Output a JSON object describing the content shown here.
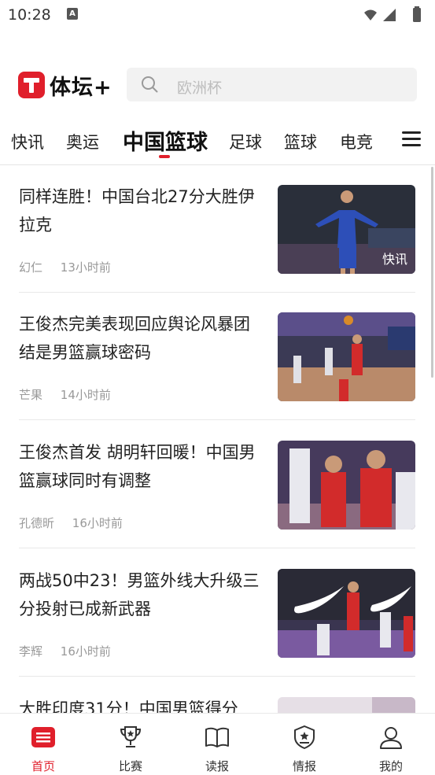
{
  "status_bar": {
    "time": "10:28",
    "notification_icon": "a-icon"
  },
  "header": {
    "logo_text": "体坛+",
    "search_placeholder": "欧洲杯"
  },
  "tabs": [
    {
      "label": "快讯"
    },
    {
      "label": "奥运"
    },
    {
      "label": "中国篮球",
      "active": true
    },
    {
      "label": "足球"
    },
    {
      "label": "篮球"
    },
    {
      "label": "电竞"
    }
  ],
  "feed": [
    {
      "title": "同样连胜！中国台北27分大胜伊拉克",
      "author": "幻仁",
      "time": "13小时前",
      "badge": "快讯"
    },
    {
      "title": "王俊杰完美表现回应舆论风暴团结是男篮赢球密码",
      "author": "芒果",
      "time": "14小时前"
    },
    {
      "title": "王俊杰首发 胡明轩回暖！中国男篮赢球同时有调整",
      "author": "孔德昕",
      "time": "16小时前"
    },
    {
      "title": "两战50中23！男篮外线大升级三分投射已成新武器",
      "author": "李辉",
      "time": "16小时前"
    },
    {
      "title": "大胜印度31分！中国男篮得分"
    }
  ],
  "bottom_nav": [
    {
      "label": "首页",
      "icon": "news-icon",
      "active": true
    },
    {
      "label": "比赛",
      "icon": "trophy-icon"
    },
    {
      "label": "读报",
      "icon": "book-icon"
    },
    {
      "label": "情报",
      "icon": "badge-icon"
    },
    {
      "label": "我的",
      "icon": "user-icon"
    }
  ],
  "colors": {
    "accent": "#e01f2b",
    "text": "#222222",
    "meta": "#999999"
  }
}
